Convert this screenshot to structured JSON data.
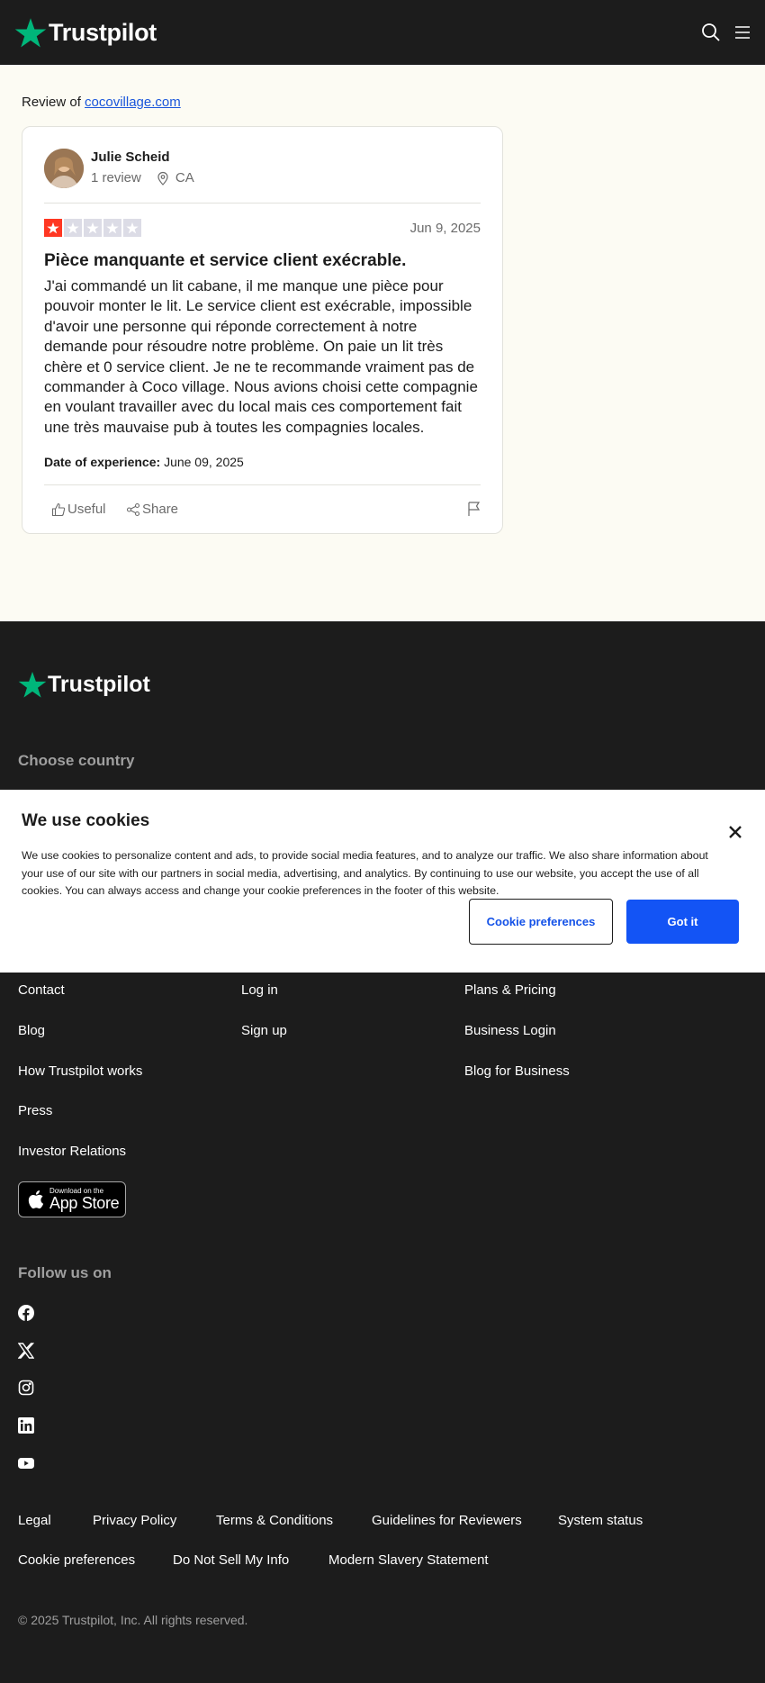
{
  "header": {
    "brand": "Trustpilot",
    "icons": [
      "search-icon",
      "menu-icon"
    ],
    "brand_color": "#00b67a"
  },
  "review": {
    "review_of_prefix": "Review of",
    "company_link": "cocovillage.com",
    "reviewer_name": "Julie Scheid",
    "reviewer_review_count": "1 review",
    "reviewer_country": "CA",
    "rating": 1,
    "rating_max": 5,
    "date": "Jun 9, 2025",
    "title": "Pièce manquante et service client exécrable.",
    "body": "J'ai commandé un lit cabane, il me manque une pièce pour pouvoir monter le lit. Le service client est exécrable, impossible d'avoir une personne qui réponde correctement à notre demande pour résoudre notre problème. On paie un lit très chère et 0 service client. Je ne te recommande vraiment pas de commander à Coco village. Nous avions choisi cette compagnie en voulant travailler avec du local mais ces comportement fait une très mauvaise pub à toutes les compagnies locales.",
    "experience_label": "Date of experience:",
    "experience_date": "June 09, 2025",
    "useful_label": "Useful",
    "share_label": "Share",
    "rating_color": "#ff3722",
    "empty_star_color": "#dcdce6"
  },
  "footer": {
    "brand": "Trustpilot",
    "choose_country": "Choose country",
    "links_col1": [
      "Contact",
      "Blog",
      "How Trustpilot works",
      "Press",
      "Investor Relations"
    ],
    "links_col2": [
      "Log in",
      "Sign up"
    ],
    "links_col3": [
      "Plans & Pricing",
      "Business Login",
      "Blog for Business"
    ],
    "appstore_small": "Download on the",
    "appstore_big": "App Store",
    "follow_us": "Follow us on",
    "social_icons": [
      "facebook-icon",
      "x-icon",
      "instagram-icon",
      "linkedin-icon",
      "youtube-icon"
    ],
    "legal_row1": [
      "Legal",
      "Privacy Policy",
      "Terms & Conditions",
      "Guidelines for Reviewers",
      "System status"
    ],
    "legal_row2": [
      "Cookie preferences",
      "Do Not Sell My Info",
      "Modern Slavery Statement"
    ],
    "copyright": "© 2025 Trustpilot, Inc. All rights reserved."
  },
  "cookie_banner": {
    "title": "We use cookies",
    "text": "We use cookies to personalize content and ads, to provide social media features, and to analyze our traffic. We also share information about your use of our site with our partners in social media, advertising, and analytics. By continuing to use our website, you accept the use of all cookies. You can always access and change your cookie preferences in the footer of this website.",
    "preferences_button": "Cookie preferences",
    "accept_button": "Got it",
    "accept_color": "#1354f5"
  }
}
